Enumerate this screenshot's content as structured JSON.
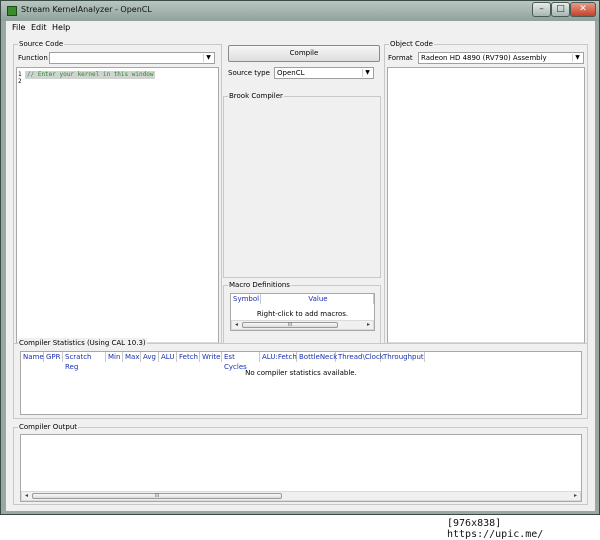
{
  "window": {
    "title": "Stream KernelAnalyzer - OpenCL",
    "min": "–",
    "max": "□",
    "close": "✕"
  },
  "menu": [
    "File",
    "Edit",
    "Help"
  ],
  "source_code": {
    "title": "Source Code",
    "function_label": "Function",
    "function_value": "",
    "line_numbers": [
      "1",
      "2"
    ],
    "code_line1": "// Enter your kernel in this window"
  },
  "middle": {
    "compile_label": "Compile",
    "source_type_label": "Source type",
    "source_type_value": "OpenCL",
    "brook_title": "Brook Compiler",
    "macro_title": "Macro Definitions",
    "macro_columns": [
      "Symbol",
      "Value"
    ],
    "macro_message": "Right-click to add macros."
  },
  "object_code": {
    "title": "Object Code",
    "format_label": "Format",
    "format_value": "Radeon HD 4890 (RV790) Assembly"
  },
  "stats": {
    "title": "Compiler Statistics (Using CAL 10.3)",
    "columns": [
      "Name",
      "GPR",
      "Scratch Reg",
      "Min",
      "Max",
      "Avg",
      "ALU",
      "Fetch",
      "Write",
      "Est Cycles",
      "ALU:Fetch",
      "BottleNeck",
      "Thread\\Clock",
      "Throughput"
    ],
    "empty_message": "No compiler statistics available."
  },
  "output": {
    "title": "Compiler Output"
  },
  "scroll": {
    "thumb": "III",
    "left": "◂",
    "right": "▸"
  },
  "watermark": "[976x838] https://upic.me/"
}
